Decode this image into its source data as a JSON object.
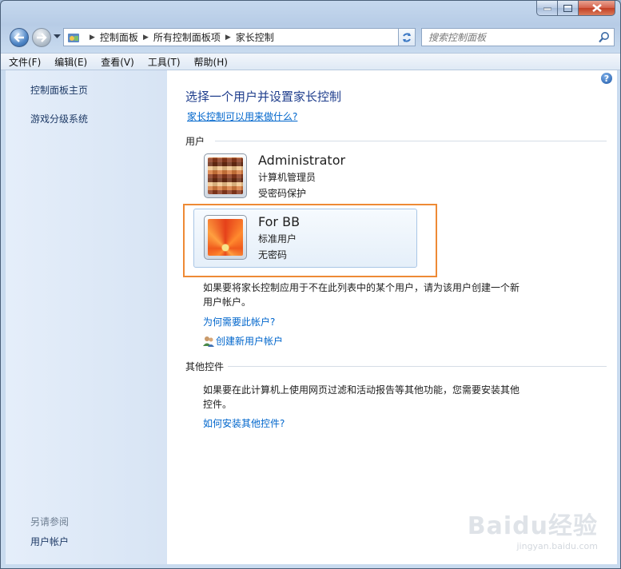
{
  "window": {
    "caption": {
      "minimize_icon": "minimize-icon",
      "maximize_icon": "maximize-icon",
      "close_icon": "close-icon"
    }
  },
  "nav": {
    "breadcrumb": [
      "控制面板",
      "所有控制面板项",
      "家长控制"
    ],
    "search_placeholder": "搜索控制面板"
  },
  "menu": [
    "文件(F)",
    "编辑(E)",
    "查看(V)",
    "工具(T)",
    "帮助(H)"
  ],
  "sidebar": {
    "home": "控制面板主页",
    "games": "游戏分级系统",
    "see_also": "另请参阅",
    "user_accounts": "用户帐户"
  },
  "main": {
    "title": "选择一个用户并设置家长控制",
    "what_link": "家长控制可以用来做什么?",
    "users_section": "用户",
    "users": [
      {
        "name": "Administrator",
        "role": "计算机管理员",
        "password": "受密码保护"
      },
      {
        "name": "For BB",
        "role": "标准用户",
        "password": "无密码"
      }
    ],
    "note_line1": "如果要将家长控制应用于不在此列表中的某个用户，请为该用户创建一个新",
    "note_line2": "用户帐户。",
    "why_link": "为何需要此帐户?",
    "create_link": "创建新用户帐户",
    "other_section": "其他控件",
    "other_line1": "如果要在此计算机上使用网页过滤和活动报告等其他功能，您需要安装其他",
    "other_line2": "控件。",
    "install_link": "如何安装其他控件?",
    "help_glyph": "?"
  },
  "watermark": {
    "logo": "Baidu经验",
    "url": "jingyan.baidu.com"
  },
  "colors": {
    "highlight": "#ee8a35",
    "link": "#0066cc",
    "title": "#1e3d8c"
  }
}
